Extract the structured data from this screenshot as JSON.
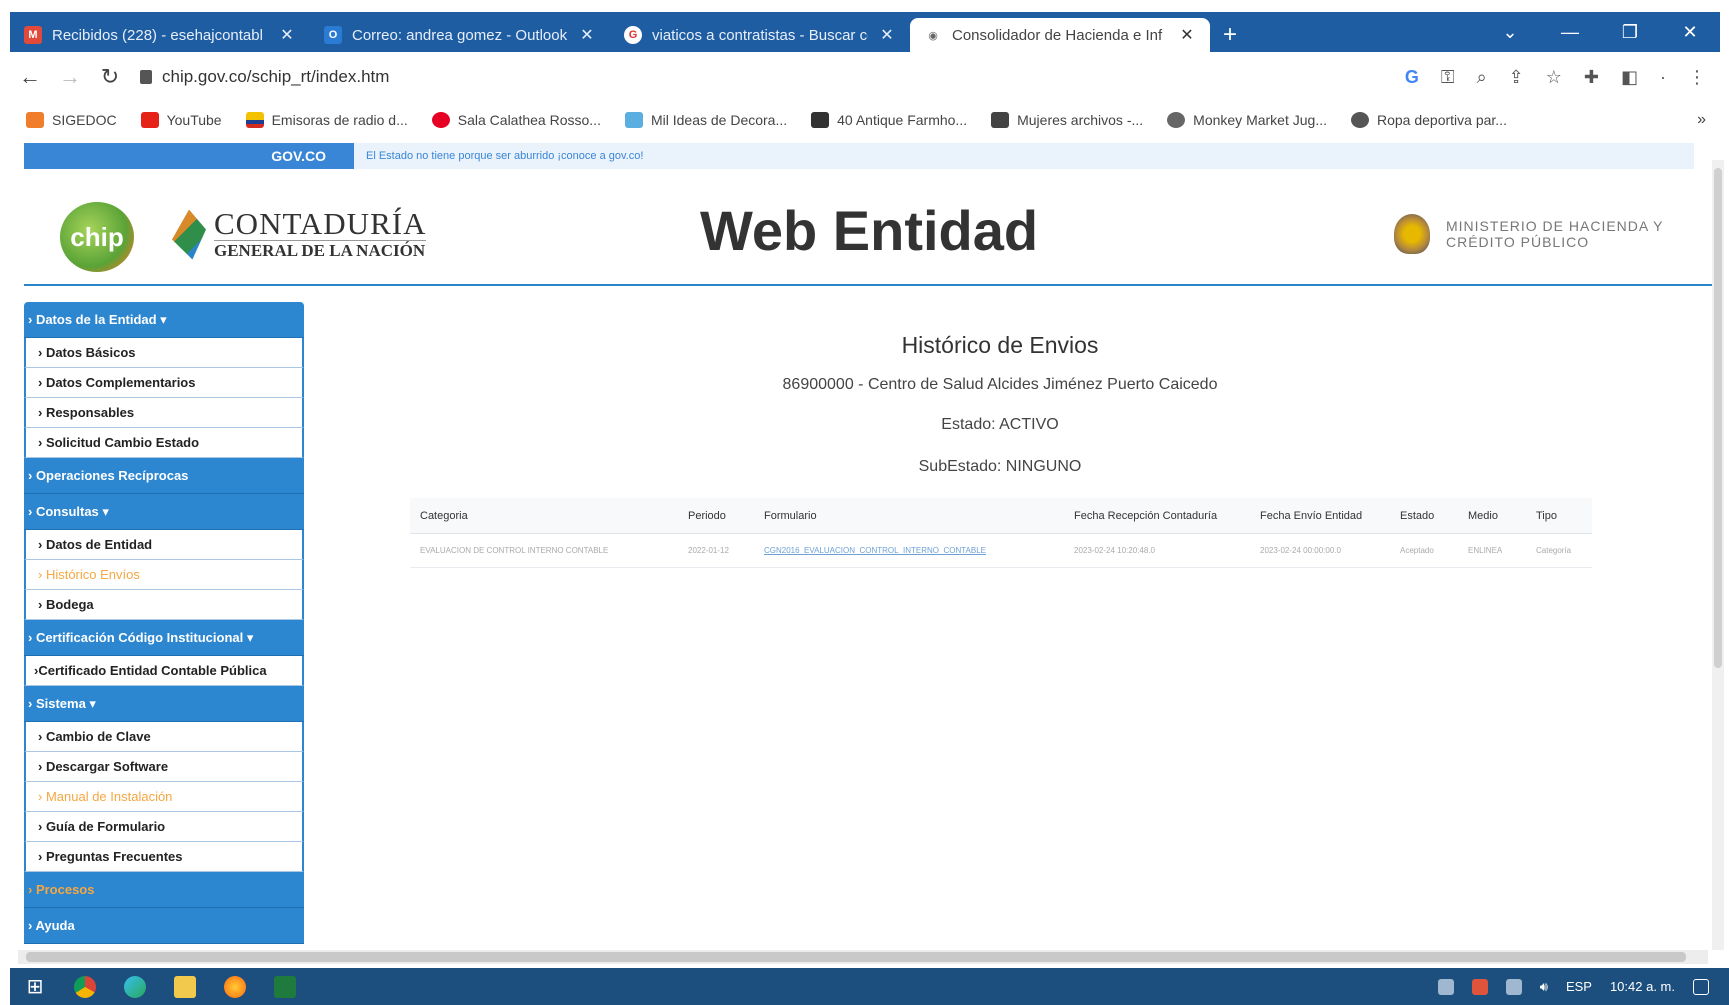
{
  "browser": {
    "tabs": [
      {
        "title": "Recibidos (228) - esehajcontabl",
        "icon_color": "#e14a3b",
        "icon_text": "M"
      },
      {
        "title": "Correo: andrea gomez - Outlook",
        "icon_color": "#2a7bd4",
        "icon_text": "O"
      },
      {
        "title": "viaticos a contratistas - Buscar co",
        "icon_color": "#ffffff",
        "icon_text": "G"
      },
      {
        "title": "Consolidador de Hacienda e Inf",
        "icon_color": "#666666",
        "icon_text": "◉"
      }
    ],
    "new_tab": "+",
    "url": "chip.gov.co/schip_rt/index.htm"
  },
  "bookmarks": [
    {
      "label": "SIGEDOC",
      "color": "#f07d2a"
    },
    {
      "label": "YouTube",
      "color": "#e62117"
    },
    {
      "label": "Emisoras de radio d...",
      "color": "#f2c200"
    },
    {
      "label": "Sala Calathea Rosso...",
      "color": "#e60023"
    },
    {
      "label": "Mil Ideas de Decora...",
      "color": "#5aaee0"
    },
    {
      "label": "40 Antique Farmho...",
      "color": "#333333"
    },
    {
      "label": "Mujeres archivos -...",
      "color": "#444444"
    },
    {
      "label": "Monkey Market Jug...",
      "color": "#666666"
    },
    {
      "label": "Ropa deportiva par...",
      "color": "#555555"
    }
  ],
  "govbar": {
    "logo": "GOV.CO",
    "message": "El Estado no tiene porque ser aburrido ¡conoce a gov.co!"
  },
  "header": {
    "chip_logo": "chip",
    "contaduria_line1": "CONTADURÍA",
    "contaduria_line2": "GENERAL DE LA NACIÓN",
    "title": "Web Entidad",
    "ministerio_line1": "MINISTERIO DE HACIENDA Y",
    "ministerio_line2": "CRÉDITO PÚBLICO"
  },
  "sidebar": {
    "datos_entidad": "› Datos de la Entidad ▾",
    "datos_basicos": "› Datos Básicos",
    "datos_complementarios": "› Datos Complementarios",
    "responsables": "› Responsables",
    "solicitud": "› Solicitud Cambio Estado",
    "operaciones": "› Operaciones Recíprocas",
    "consultas": "› Consultas ▾",
    "datos_de_entidad": "› Datos de Entidad",
    "historico": "› Histórico Envíos",
    "bodega": "› Bodega",
    "certificacion": "› Certificación Código Institucional ▾",
    "certificado": "›Certificado Entidad Contable Pública",
    "sistema": "› Sistema ▾",
    "cambio_clave": "› Cambio de Clave",
    "descargar": "› Descargar Software",
    "manual": "› Manual de Instalación",
    "guia": "› Guía de Formulario",
    "preguntas": "› Preguntas Frecuentes",
    "procesos": "› Procesos",
    "ayuda": "› Ayuda"
  },
  "main": {
    "title": "Histórico de Envios",
    "entity": "86900000 - Centro de Salud Alcides Jiménez Puerto Caicedo",
    "estado": "Estado: ACTIVO",
    "subestado": "SubEstado: NINGUNO"
  },
  "table": {
    "headers": {
      "categoria": "Categoria",
      "periodo": "Periodo",
      "formulario": "Formulario",
      "fecha_recepcion": "Fecha Recepción Contaduría",
      "fecha_envio": "Fecha Envío Entidad",
      "estado": "Estado",
      "medio": "Medio",
      "tipo": "Tipo"
    },
    "row": {
      "categoria": "EVALUACION DE CONTROL INTERNO CONTABLE",
      "periodo": "2022-01-12",
      "formulario": "CGN2016_EVALUACION_CONTROL_INTERNO_CONTABLE",
      "fecha_recepcion": "2023-02-24 10:20:48.0",
      "fecha_envio": "2023-02-24 00:00:00.0",
      "estado": "Aceptado",
      "medio": "ENLINEA",
      "tipo": "Categoría"
    }
  },
  "taskbar": {
    "language": "ESP",
    "time": "10:42 a. m."
  }
}
